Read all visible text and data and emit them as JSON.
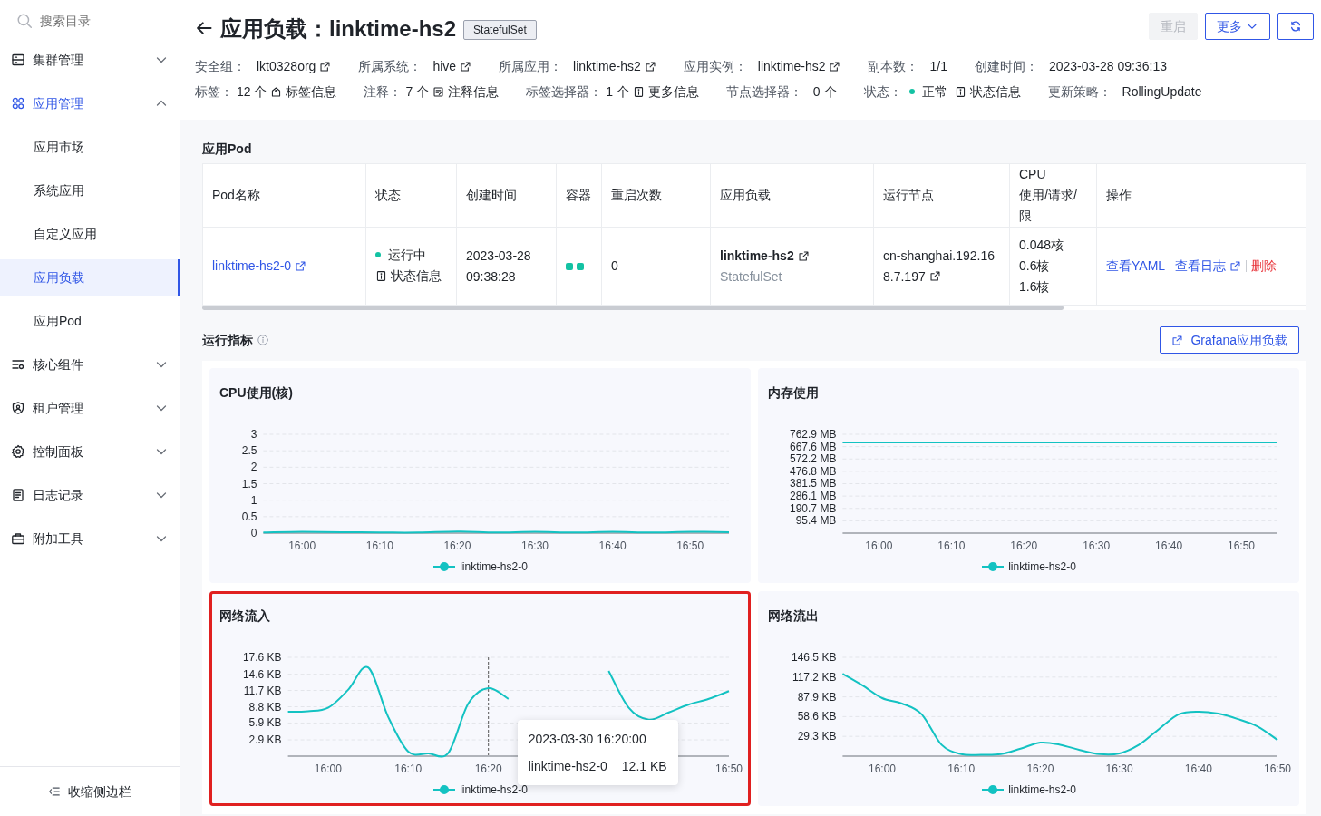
{
  "sidebar": {
    "search": {
      "placeholder": "搜索目录"
    },
    "items": [
      {
        "label": "集群管理",
        "selected": false,
        "expanded": false
      },
      {
        "label": "应用管理",
        "selected": true,
        "expanded": true,
        "children": [
          {
            "label": "应用市场",
            "selected": false
          },
          {
            "label": "系统应用",
            "selected": false
          },
          {
            "label": "自定义应用",
            "selected": false
          },
          {
            "label": "应用负载",
            "selected": true
          },
          {
            "label": "应用Pod",
            "selected": false
          }
        ]
      },
      {
        "label": "核心组件",
        "selected": false,
        "expanded": false
      },
      {
        "label": "租户管理",
        "selected": false,
        "expanded": false
      },
      {
        "label": "控制面板",
        "selected": false,
        "expanded": false
      },
      {
        "label": "日志记录",
        "selected": false,
        "expanded": false
      },
      {
        "label": "附加工具",
        "selected": false,
        "expanded": false
      }
    ],
    "collapse_label": "收缩侧边栏"
  },
  "header": {
    "title": "应用负载：linktime-hs2",
    "badge": "StatefulSet",
    "buttons": [
      {
        "kind": "text",
        "label": "重启",
        "disabled": true
      },
      {
        "kind": "dropdown",
        "label": "更多",
        "disabled": false
      },
      {
        "kind": "refresh",
        "disabled": false
      }
    ],
    "info_rows": [
      [
        {
          "label": "安全组：",
          "value": "lkt0328org",
          "kind": "link"
        },
        {
          "label": "所属系统：",
          "value": "hive",
          "kind": "link"
        },
        {
          "label": "所属应用：",
          "value": "linktime-hs2",
          "kind": "link"
        },
        {
          "label": "应用实例：",
          "value": "linktime-hs2",
          "kind": "link"
        },
        {
          "label": "副本数：",
          "value": "1/1",
          "kind": "text"
        },
        {
          "label": "创建时间：",
          "value": "2023-03-28 09:36:13",
          "kind": "text"
        }
      ],
      [
        {
          "label": "标签：",
          "value": "12 个",
          "kind": "tags",
          "info": "标签信息"
        },
        {
          "label": "注释：",
          "value": "7 个",
          "kind": "notes",
          "info": "注释信息"
        },
        {
          "label": "标签选择器：",
          "value": "1 个",
          "kind": "details",
          "info": "更多信息"
        },
        {
          "label": "节点选择器：",
          "value": "0 个",
          "kind": "text"
        },
        {
          "label": "状态：",
          "value": "正常",
          "kind": "status",
          "color": "#13c2a3",
          "info": "状态信息"
        },
        {
          "label": "更新策略：",
          "value": "RollingUpdate",
          "kind": "text"
        }
      ]
    ]
  },
  "pods": {
    "title": "应用Pod",
    "columns": [
      [
        "Pod名称"
      ],
      [
        "状态"
      ],
      [
        "创建时间"
      ],
      [
        "容器"
      ],
      [
        "重启次数"
      ],
      [
        "应用负载"
      ],
      [
        "运行节点"
      ],
      [
        "CPU",
        "使用/请求/限"
      ],
      [
        "操作"
      ]
    ],
    "rows": [
      {
        "name": "linktime-hs2-0",
        "status": {
          "label": "运行中",
          "color": "#13c2a3"
        },
        "status_info": "状态信息",
        "created": "2023-03-28 09:38:28",
        "containers": [
          {
            "ready": true
          },
          {
            "ready": true
          }
        ],
        "restarts": "0",
        "workload": "linktime-hs2",
        "workload_kind": "StatefulSet",
        "node": "cn-shanghai.192.168.7.197",
        "cpu": [
          "0.048核",
          "0.6核",
          "1.6核"
        ],
        "actions": [
          {
            "label": "查看YAML",
            "kind": "link"
          },
          {
            "label": "查看日志",
            "kind": "external"
          },
          {
            "label": "删除",
            "kind": "danger"
          }
        ]
      }
    ]
  },
  "metrics": {
    "title": "运行指标",
    "grafana_button": "Grafana应用负载",
    "charts": [
      {
        "title": "CPU使用(核)",
        "highlighted": false,
        "chart_data": {
          "type": "line",
          "categories": [
            null,
            "16:00",
            null,
            "16:10",
            null,
            "16:20",
            null,
            "16:30",
            null,
            "16:40",
            null,
            "16:50",
            null
          ],
          "ylim": [
            0,
            3
          ],
          "grid": true,
          "yticks": [
            0,
            0.5,
            1,
            1.5,
            2,
            2.5,
            3
          ],
          "series": [
            {
              "name": "linktime-hs2-0",
              "color": "#13c2c2",
              "values": [
                0.02,
                0.04,
                0.03,
                0.02,
                0.02,
                0.05,
                0.02,
                0.04,
                0.02,
                0.04,
                0.02,
                0.04,
                0.03
              ]
            }
          ]
        }
      },
      {
        "title": "内存使用",
        "highlighted": false,
        "chart_data": {
          "type": "line",
          "categories": [
            null,
            "16:00",
            null,
            "16:10",
            null,
            "16:20",
            null,
            "16:30",
            null,
            "16:40",
            null,
            "16:50",
            null
          ],
          "ylim": [
            0,
            762.9
          ],
          "grid": true,
          "yticks": [
            {
              "value": 95.4,
              "label": "95.4 MB"
            },
            {
              "value": 190.7,
              "label": "190.7 MB"
            },
            {
              "value": 286.1,
              "label": "286.1 MB"
            },
            {
              "value": 381.5,
              "label": "381.5 MB"
            },
            {
              "value": 476.8,
              "label": "476.8 MB"
            },
            {
              "value": 572.2,
              "label": "572.2 MB"
            },
            {
              "value": 667.6,
              "label": "667.6 MB"
            },
            {
              "value": 762.9,
              "label": "762.9 MB"
            }
          ],
          "series": [
            {
              "name": "linktime-hs2-0",
              "color": "#13c2c2",
              "values": [
                700,
                700,
                700,
                700,
                700,
                700,
                700,
                700,
                700,
                700,
                700,
                700,
                700
              ]
            }
          ]
        }
      },
      {
        "title": "网络流入",
        "highlighted": true,
        "tooltip": {
          "title": "2023-03-30 16:20:00",
          "series": "linktime-hs2-0",
          "value": "12.1 KB"
        },
        "chart_data": {
          "type": "line",
          "categories": [
            null,
            null,
            "16:00",
            null,
            null,
            null,
            "16:10",
            null,
            null,
            null,
            "16:20",
            null,
            null,
            null,
            null,
            null,
            null,
            null,
            null,
            null,
            null,
            null,
            "16:50"
          ],
          "ylim": [
            0,
            17.6
          ],
          "yticks": [
            {
              "value": 2.9,
              "label": "2.9 KB"
            },
            {
              "value": 5.9,
              "label": "5.9 KB"
            },
            {
              "value": 8.8,
              "label": "8.8 KB"
            },
            {
              "value": 11.7,
              "label": "11.7 KB"
            },
            {
              "value": 14.6,
              "label": "14.6 KB"
            },
            {
              "value": 17.6,
              "label": "17.6 KB"
            }
          ],
          "annotations": [
            {
              "x": "16:20"
            }
          ],
          "grid": true,
          "series": [
            {
              "name": "linktime-hs2-0",
              "color": "#13c2c2",
              "values": [
                7.9,
                8.0,
                8.6,
                11.8,
                15.8,
                7.0,
                0.8,
                0.5,
                0.6,
                9.4,
                12.1,
                10.2,
                null,
                null,
                null,
                null,
                15.2,
                8.6,
                6.5,
                7.8,
                9.2,
                10.2,
                11.6
              ]
            }
          ]
        }
      },
      {
        "title": "网络流出",
        "highlighted": false,
        "chart_data": {
          "type": "line",
          "categories": [
            null,
            null,
            "16:00",
            null,
            null,
            null,
            "16:10",
            null,
            null,
            null,
            "16:20",
            null,
            null,
            null,
            "16:30",
            null,
            null,
            null,
            "16:40",
            null,
            null,
            null,
            "16:50"
          ],
          "ylim": [
            0,
            146.5
          ],
          "grid": true,
          "yticks": [
            {
              "value": 29.3,
              "label": "29.3 KB"
            },
            {
              "value": 58.6,
              "label": "58.6 KB"
            },
            {
              "value": 87.9,
              "label": "87.9 KB"
            },
            {
              "value": 117.2,
              "label": "117.2 KB"
            },
            {
              "value": 146.5,
              "label": "146.5 KB"
            }
          ],
          "series": [
            {
              "name": "linktime-hs2-0",
              "color": "#13c2c2",
              "values": [
                122,
                105,
                86,
                78,
                62,
                17,
                3,
                2,
                3,
                11,
                20,
                17,
                9,
                3,
                4,
                17,
                40,
                62,
                66,
                63,
                55,
                44,
                24
              ]
            }
          ]
        }
      }
    ]
  }
}
